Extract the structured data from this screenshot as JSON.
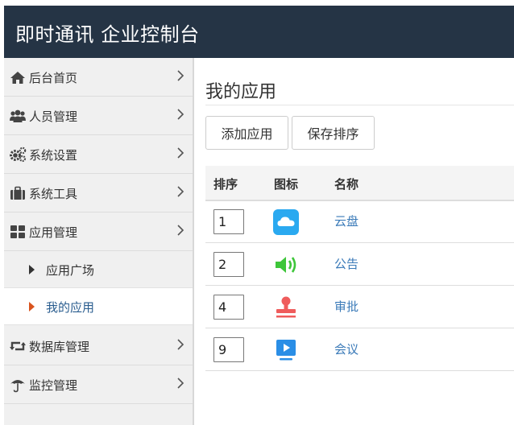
{
  "header": {
    "title": "即时通讯 企业控制台"
  },
  "sidebar": {
    "items": [
      {
        "label": "后台首页",
        "icon": "home-icon"
      },
      {
        "label": "人员管理",
        "icon": "users-icon"
      },
      {
        "label": "系统设置",
        "icon": "gears-icon"
      },
      {
        "label": "系统工具",
        "icon": "briefcase-icon"
      },
      {
        "label": "应用管理",
        "icon": "grid-icon"
      },
      {
        "label": "数据库管理",
        "icon": "retweet-icon"
      },
      {
        "label": "监控管理",
        "icon": "umbrella-icon"
      }
    ],
    "subitems": [
      {
        "label": "应用广场"
      },
      {
        "label": "我的应用",
        "active": true
      }
    ]
  },
  "main": {
    "title": "我的应用",
    "buttons": {
      "add": "添加应用",
      "save": "保存排序"
    },
    "table": {
      "headers": [
        "排序",
        "图标",
        "名称"
      ],
      "rows": [
        {
          "order": "1",
          "icon": "cloud-icon",
          "icon_color": "#2aa9f0",
          "name": "云盘"
        },
        {
          "order": "2",
          "icon": "speaker-icon",
          "icon_color": "#3ec63a",
          "name": "公告"
        },
        {
          "order": "4",
          "icon": "stamp-icon",
          "icon_color": "#ef5c5c",
          "name": "审批"
        },
        {
          "order": "9",
          "icon": "video-play-icon",
          "icon_color": "#2a8ee6",
          "name": "会议"
        }
      ]
    }
  },
  "colors": {
    "header_bg": "#253445",
    "link": "#3a7ab8",
    "active_arrow": "#d9541e"
  }
}
